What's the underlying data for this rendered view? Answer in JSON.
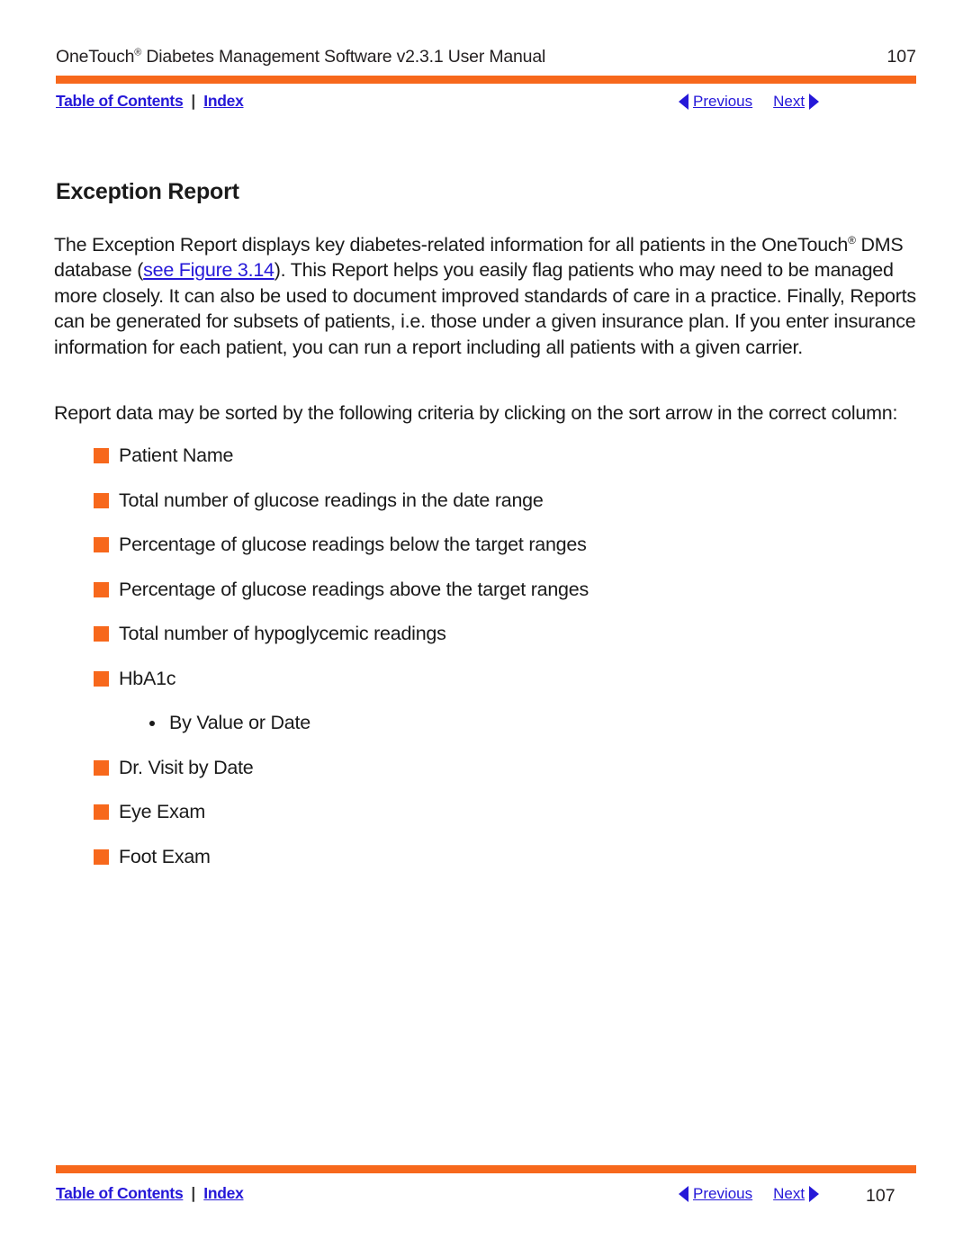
{
  "header": {
    "title_prefix": "OneTouch",
    "title_sup": "®",
    "title_rest": " Diabetes Management Software v2.3.1 User Manual",
    "page_number": "107"
  },
  "nav": {
    "toc_label": "Table of Contents",
    "separator": "|",
    "index_label": "Index",
    "previous_label": "Previous",
    "next_label": "Next",
    "prev_icon": "triangle-left-icon",
    "next_icon": "triangle-right-icon"
  },
  "content": {
    "section_title": "Exception Report",
    "paragraph_1": {
      "part_a": "The Exception Report displays key diabetes-related information for all patients in the OneTouch",
      "sup": "®",
      "part_b": " DMS database (",
      "link": "see Figure 3.14",
      "part_c": "). This Report helps you easily flag patients who may need to be managed more closely. It can also be used to document improved standards of care in a practice. Finally, Reports can be generated for subsets of patients, i.e. those under a given insurance plan. If you enter insurance information for each patient, you can run a report including all patients with a given carrier."
    },
    "paragraph_2": "Report data may be sorted by the following criteria by clicking on the sort arrow in the correct column:",
    "bullets": [
      {
        "text": "Patient Name",
        "level": 1
      },
      {
        "text": "Total number of glucose readings in the date range",
        "level": 1
      },
      {
        "text": "Percentage of glucose readings below the target ranges",
        "level": 1
      },
      {
        "text": "Percentage of glucose readings above the target ranges",
        "level": 1
      },
      {
        "text": "Total number of hypoglycemic readings",
        "level": 1
      },
      {
        "text": "HbA1c",
        "level": 1
      },
      {
        "text": "By Value or Date",
        "level": 2
      },
      {
        "text": "Dr. Visit by Date",
        "level": 1
      },
      {
        "text": "Eye Exam",
        "level": 1
      },
      {
        "text": "Foot Exam",
        "level": 1
      }
    ]
  },
  "footer": {
    "page_number": "107"
  },
  "colors": {
    "accent_orange": "#F7681C",
    "link_blue": "#2518D8",
    "text_black": "#1a1a1a"
  }
}
